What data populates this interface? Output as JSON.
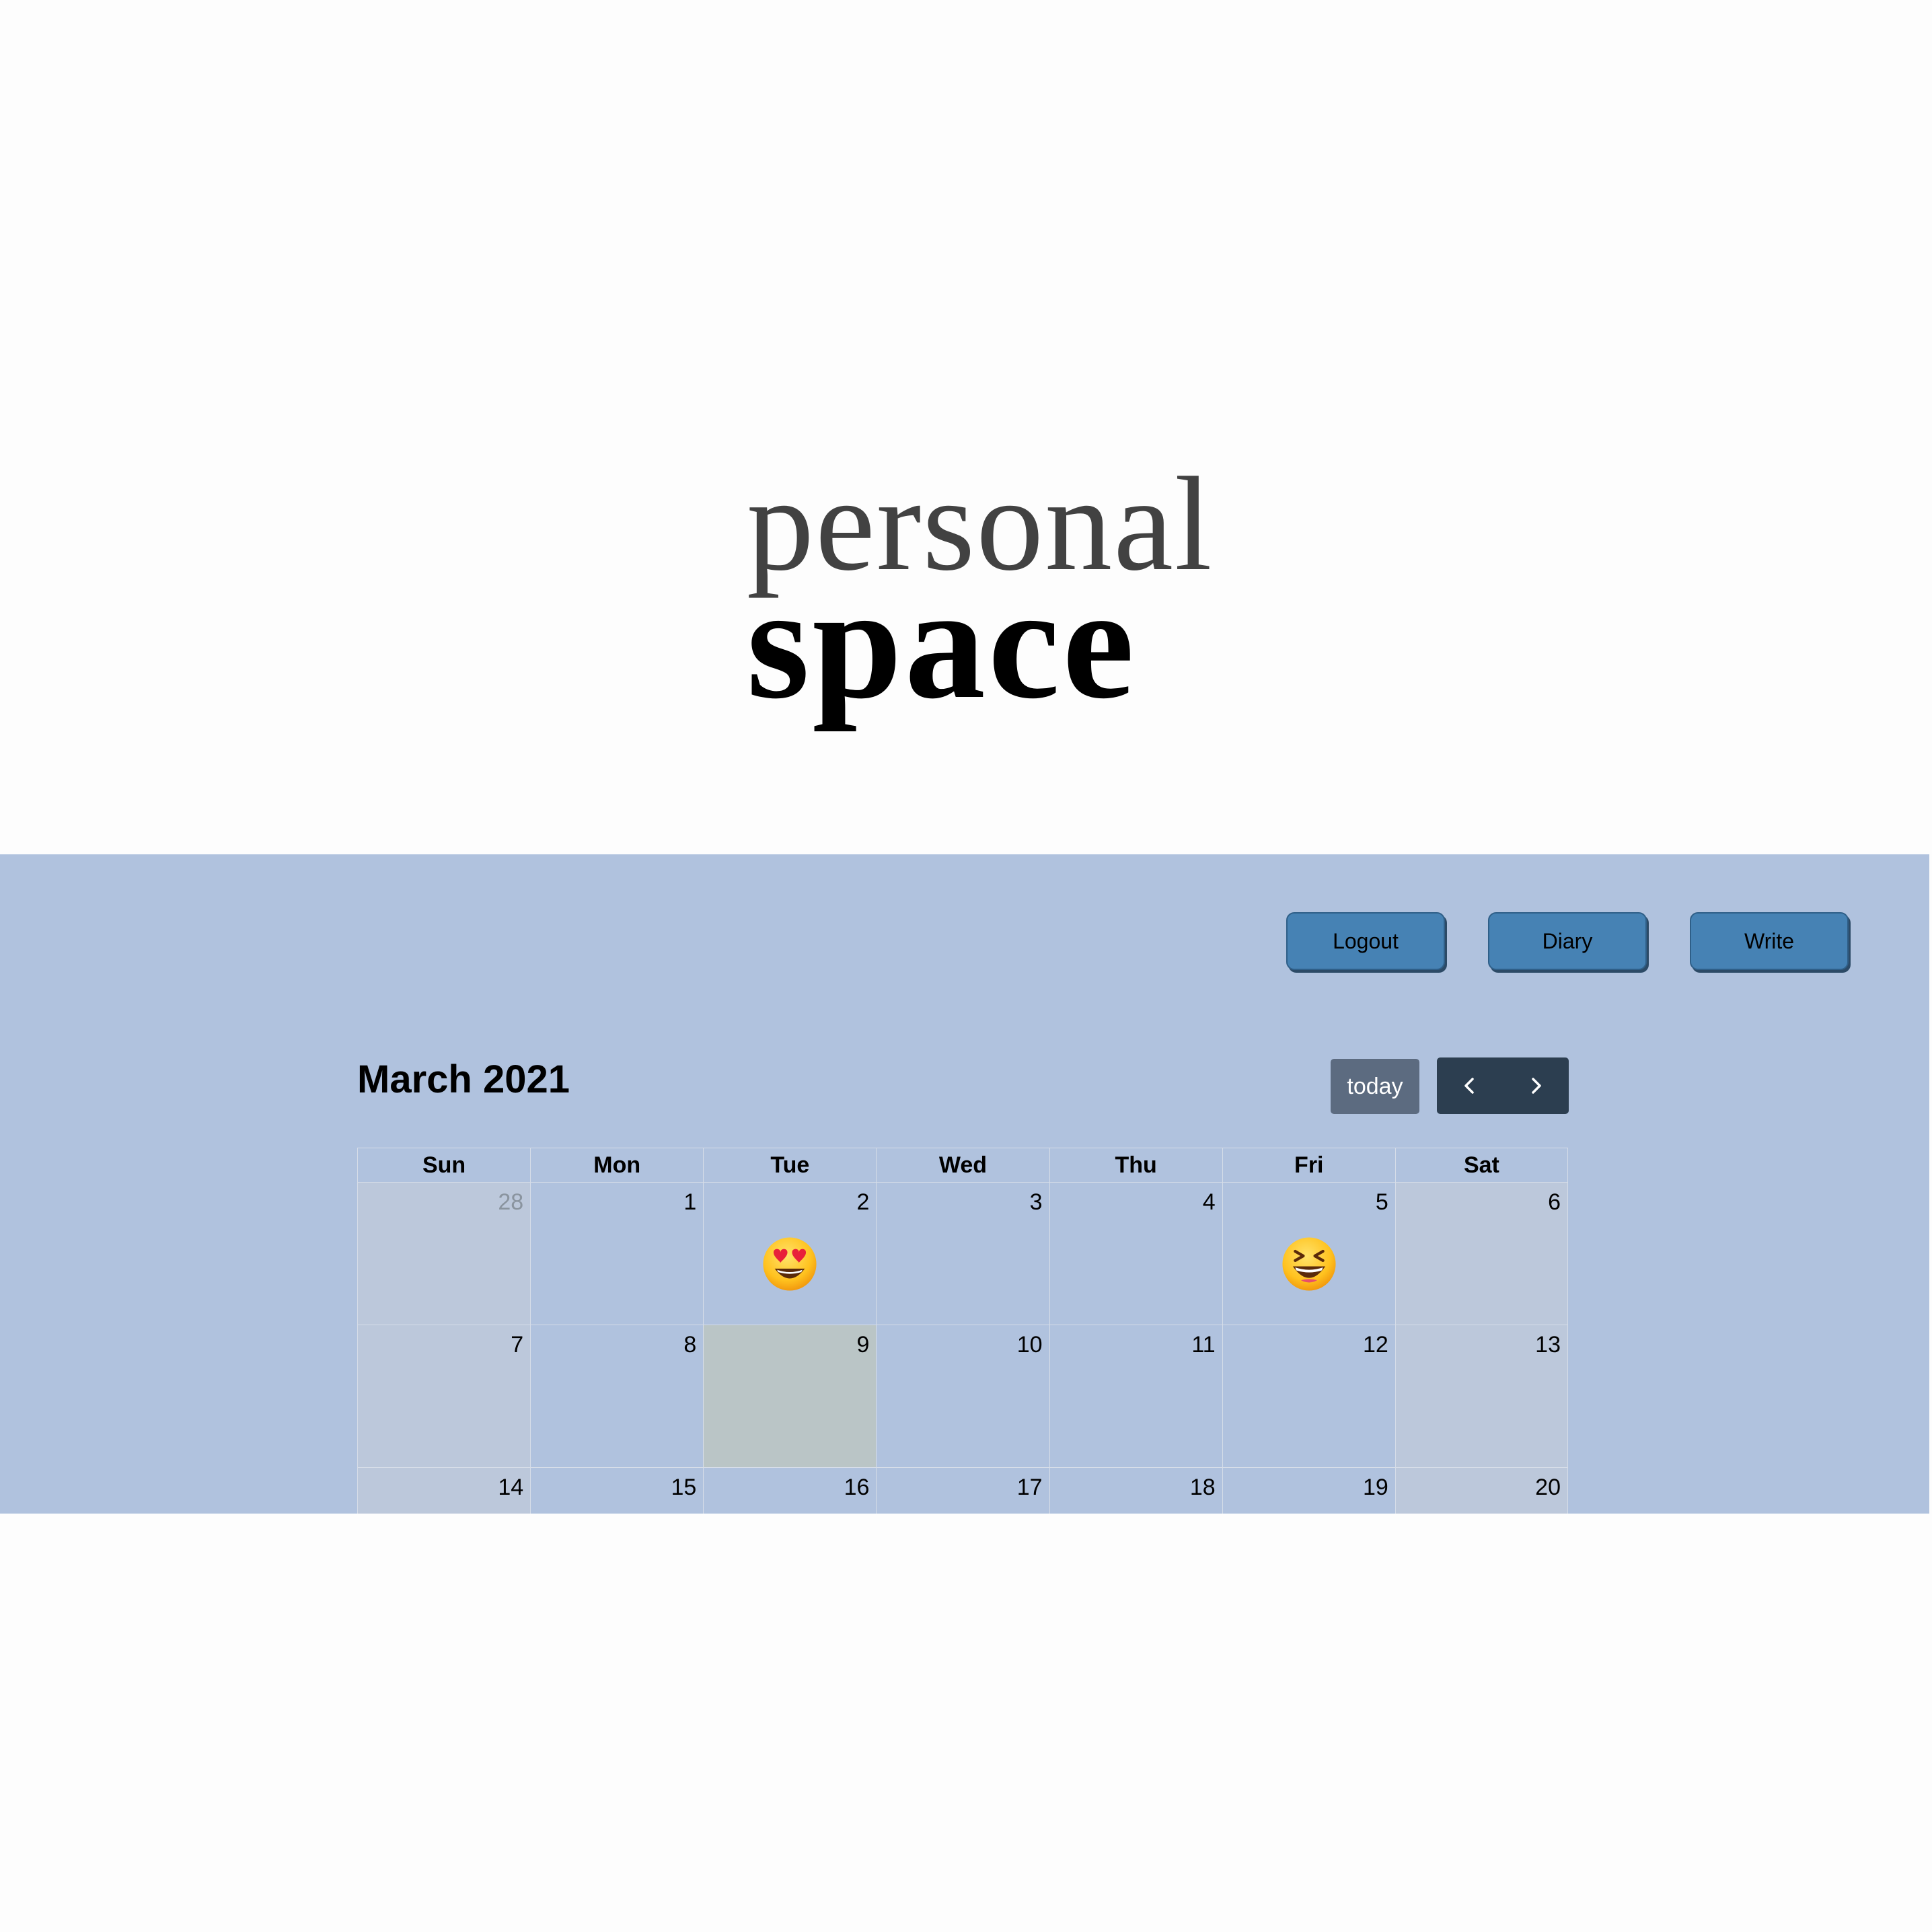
{
  "logo": {
    "line1": "personal",
    "line2": "space"
  },
  "nav": {
    "logout_label": "Logout",
    "diary_label": "Diary",
    "write_label": "Write"
  },
  "calendar": {
    "title": "March 2021",
    "today_label": "today",
    "prev_icon": "chevron-left-icon",
    "next_icon": "chevron-right-icon",
    "weekdays": [
      "Sun",
      "Mon",
      "Tue",
      "Wed",
      "Thu",
      "Fri",
      "Sat"
    ],
    "weeks": [
      [
        {
          "day": "28",
          "other": true
        },
        {
          "day": "1"
        },
        {
          "day": "2",
          "mood": "heart-eyes-emoji-icon"
        },
        {
          "day": "3"
        },
        {
          "day": "4"
        },
        {
          "day": "5",
          "mood": "grinning-squinting-emoji-icon"
        },
        {
          "day": "6"
        }
      ],
      [
        {
          "day": "7"
        },
        {
          "day": "8"
        },
        {
          "day": "9",
          "today": true
        },
        {
          "day": "10"
        },
        {
          "day": "11"
        },
        {
          "day": "12"
        },
        {
          "day": "13"
        }
      ],
      [
        {
          "day": "14"
        },
        {
          "day": "15"
        },
        {
          "day": "16"
        },
        {
          "day": "17"
        },
        {
          "day": "18"
        },
        {
          "day": "19"
        },
        {
          "day": "20"
        }
      ]
    ]
  },
  "colors": {
    "band_background": "#b0c2de",
    "nav_button": "#4682b4",
    "today_button": "#5c6b80",
    "arrow_group": "#2c3e50",
    "weekend_cell": "#bcc8db",
    "today_cell": "#bac5c6"
  }
}
